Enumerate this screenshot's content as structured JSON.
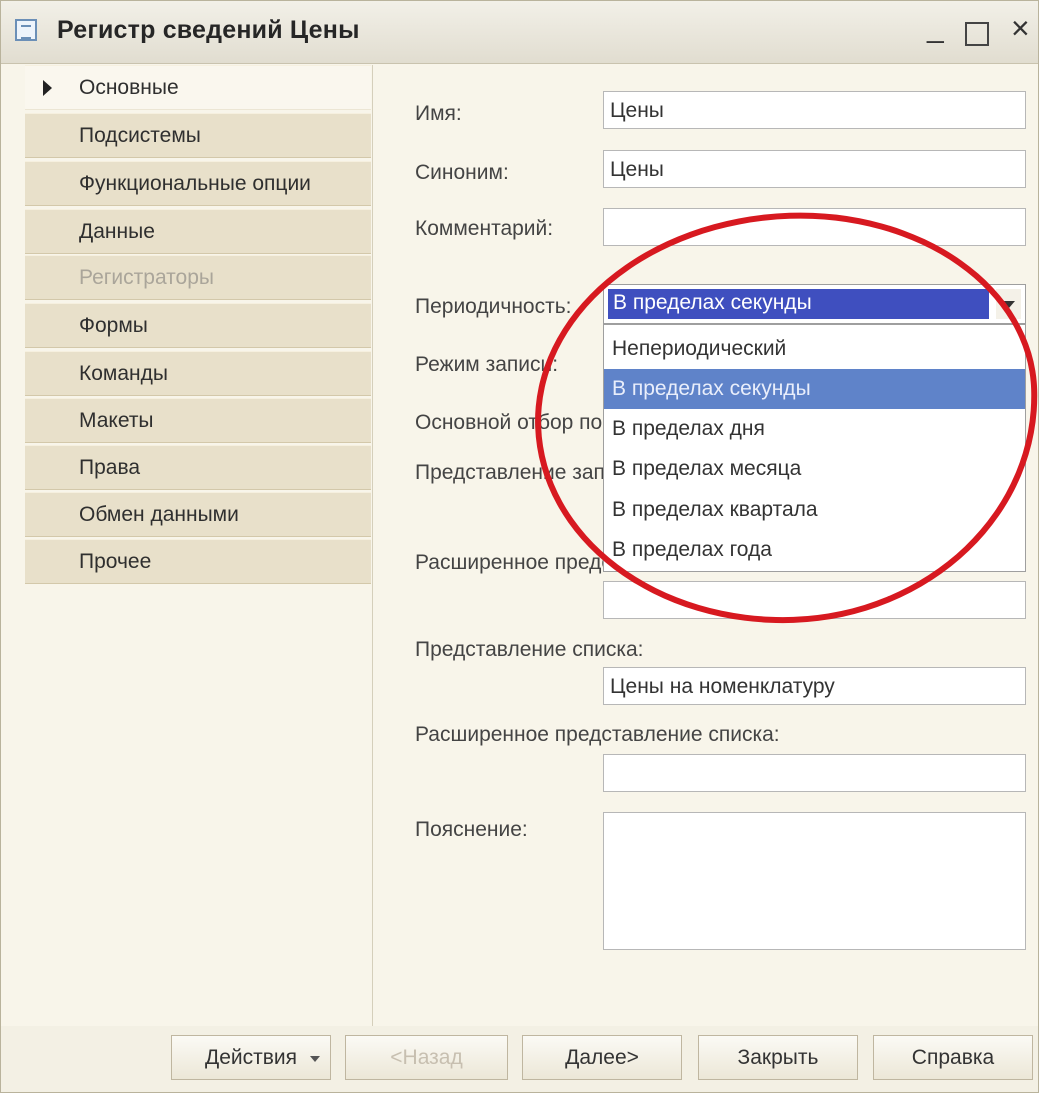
{
  "window": {
    "title": "Регистр сведений Цены",
    "minimize_label": "_",
    "close_label": "×"
  },
  "sidebar": {
    "tabs": [
      {
        "label": "Основные"
      },
      {
        "label": "Подсистемы"
      },
      {
        "label": "Функциональные опции"
      },
      {
        "label": "Данные"
      },
      {
        "label": "Регистраторы"
      },
      {
        "label": "Формы"
      },
      {
        "label": "Команды"
      },
      {
        "label": "Макеты"
      },
      {
        "label": "Права"
      },
      {
        "label": "Обмен данными"
      },
      {
        "label": "Прочее"
      }
    ]
  },
  "form": {
    "name_label": "Имя:",
    "name_value": "Цены",
    "synonym_label": "Синоним:",
    "synonym_value": "Цены",
    "comment_label": "Комментарий:",
    "comment_value": "",
    "periodicity_label": "Периодичность:",
    "periodicity_value": "В пределах секунды",
    "periodicity_options": [
      "Непериодический",
      "В пределах секунды",
      "В пределах дня",
      "В пределах месяца",
      "В пределах квартала",
      "В пределах года"
    ],
    "write_mode_label": "Режим записи:",
    "main_filter_label": "Основной отбор по периоду:",
    "record_presentation_label": "Представление записи:",
    "extended_record_presentation_label": "Расширенное представление записи:",
    "list_presentation_label": "Представление списка:",
    "list_presentation_value": "Цены на номенклатуру",
    "extended_list_presentation_label": "Расширенное представление списка:",
    "explanation_label": "Пояснение:"
  },
  "buttons": {
    "actions": "Действия",
    "back": "<Назад",
    "next": "Далее>",
    "close": "Закрыть",
    "help": "Справка"
  },
  "colors": {
    "selection": "#5f83c9",
    "annotation_circle": "#d71920"
  }
}
